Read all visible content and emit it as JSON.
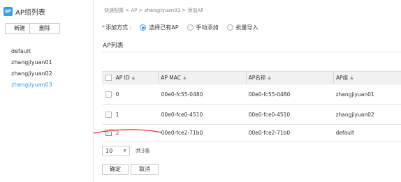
{
  "left_panel": {
    "title": "AP组列表",
    "icon_label": "AP",
    "new_button": "新建",
    "delete_button": "删除",
    "groups": [
      "default",
      "zhangjiyuan01",
      "zhangjiyuan02",
      "zhangjiyuan03"
    ],
    "selected_group": "zhangjiyuan03"
  },
  "main": {
    "breadcrumb": "快速配置 > AP > zhangjiyuan03 > 添加AP",
    "add_method_required": "*",
    "add_method_label": "添加方式 :",
    "radios": [
      {
        "label": "选择已有AP",
        "selected": true
      },
      {
        "label": "手动添加",
        "selected": false
      },
      {
        "label": "批量导入",
        "selected": false
      }
    ],
    "section_title": "AP列表",
    "table": {
      "headers": {
        "id": "AP ID",
        "mac": "AP MAC",
        "name": "AP名称",
        "group": "AP组"
      },
      "sort_symbol": "▲",
      "rows": [
        {
          "id": "0",
          "mac": "00e0-fc55-0480",
          "name": "00e0-fc55-0480",
          "group": "zhangjiyuan01",
          "checked": false
        },
        {
          "id": "1",
          "mac": "00e0-fce0-4510",
          "name": "00e0-fce0-4510",
          "group": "zhangjiyuan02",
          "checked": false
        },
        {
          "id": "2",
          "mac": "00e0-fce2-71b0",
          "name": "00e0-fce2-71b0",
          "group": "default",
          "checked": true
        }
      ]
    },
    "pager": {
      "page_size": "10",
      "total": "共3条"
    },
    "ok_button": "确定",
    "cancel_button": "取消"
  },
  "colors": {
    "accent": "#3a9ee6",
    "annotation": "#e02020"
  }
}
